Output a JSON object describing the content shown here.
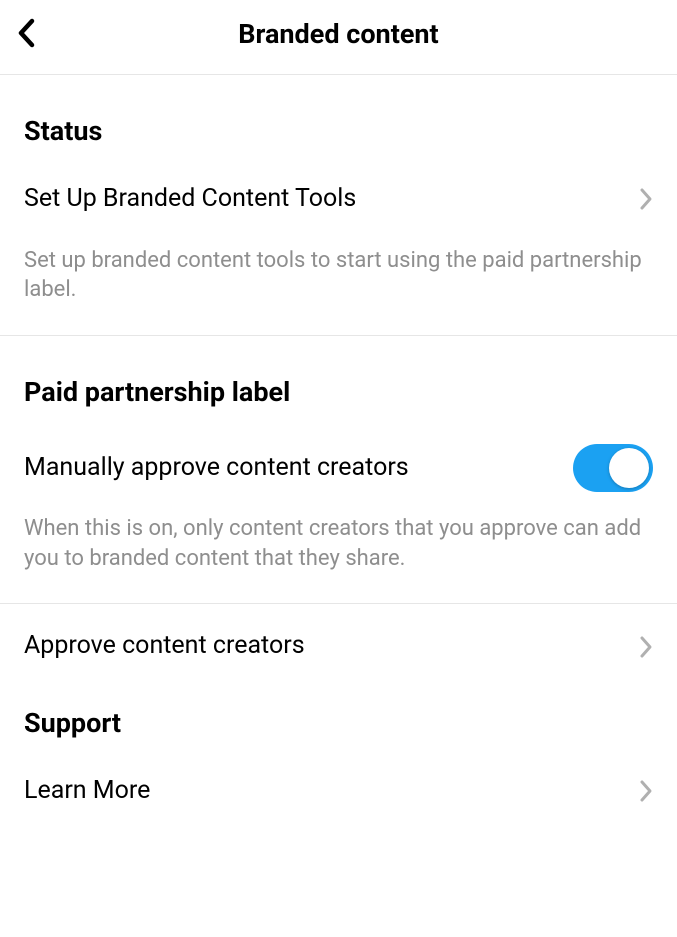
{
  "header": {
    "title": "Branded content"
  },
  "sections": {
    "status": {
      "heading": "Status",
      "setup_label": "Set Up Branded Content Tools",
      "description": "Set up branded content tools to start using the paid partnership label."
    },
    "paid": {
      "heading": "Paid partnership label",
      "manual_approve_label": "Manually approve content creators",
      "manual_approve_on": true,
      "description": "When this is on, only content creators that you approve can add you to branded content that they share.",
      "approve_creators_label": "Approve content creators"
    },
    "support": {
      "heading": "Support",
      "learn_more_label": "Learn More"
    }
  }
}
